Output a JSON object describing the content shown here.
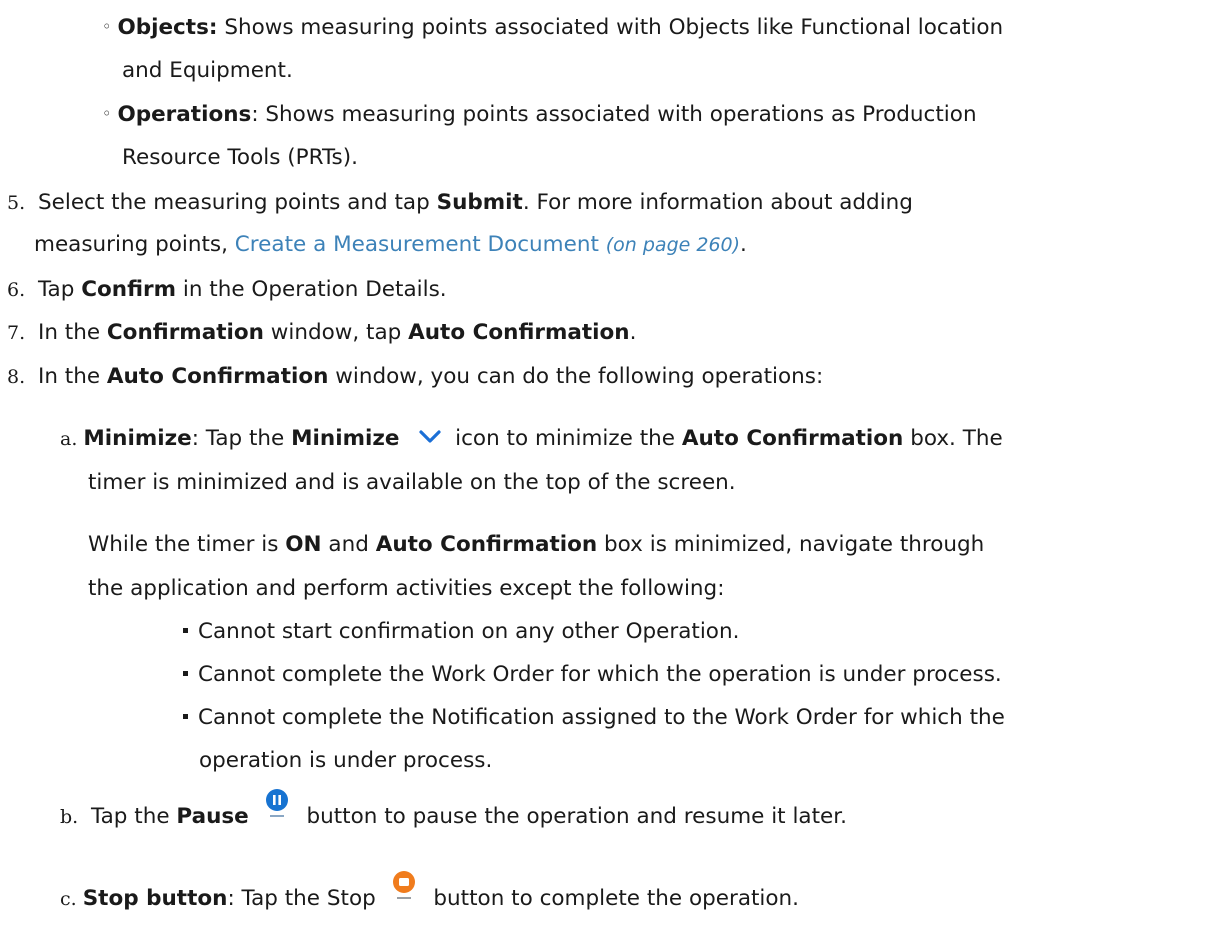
{
  "colors": {
    "text": "#1a1a1a",
    "link": "#3d82b8",
    "chevron": "#1b6fd6",
    "pause": "#1773d1",
    "stop": "#f07c1d"
  },
  "lines": {
    "objects_a": "Objects:",
    "objects_b": " Shows measuring points associated with Objects like Functional location",
    "objects_c": "and Equipment.",
    "ops_a": "Operations",
    "ops_b": ": Shows measuring points associated with operations as Production",
    "ops_c": "Resource Tools (PRTs).",
    "s5_num": "5.",
    "s5_a": " Select the measuring points and tap ",
    "s5_b": "Submit",
    "s5_c": ". For more information about adding",
    "s5_d": "measuring points, ",
    "s5_link": "Create a Measurement Document",
    "s5_link_page": "(on page 260)",
    "s5_e": ".",
    "s6_num": "6.",
    "s6_a": " Tap ",
    "s6_b": "Confirm",
    "s6_c": " in the Operation Details.",
    "s7_num": "7.",
    "s7_a": " In the ",
    "s7_b": "Confirmation",
    "s7_c": " window, tap ",
    "s7_d": "Auto Confirmation",
    "s7_e": ".",
    "s8_num": "8.",
    "s8_a": " In the ",
    "s8_b": "Auto Confirmation",
    "s8_c": " window, you can do the following operations:",
    "a_num": "a.",
    "a_b1": "Minimize",
    "a_t1": ": Tap the ",
    "a_b2": "Minimize",
    "a_t2": " icon to minimize the ",
    "a_b3": "Auto Confirmation",
    "a_t3": " box. The",
    "a_t4": "timer is minimized and is available on the top of the screen.",
    "p_t1": "While the timer is ",
    "p_b1": "ON",
    "p_t2": " and ",
    "p_b2": "Auto Confirmation",
    "p_t3": " box is minimized, navigate through",
    "p_t4": "the application and perform activities except the following:",
    "bul1": "Cannot start confirmation on any other Operation.",
    "bul2": "Cannot complete the Work Order for which the operation is under process.",
    "bul3a": "Cannot complete the Notification assigned to the Work Order for which the",
    "bul3b": "operation is under process.",
    "b_num": "b.",
    "b_t1": " Tap the ",
    "b_b1": "Pause",
    "b_t2": " button to pause the operation and resume it later.",
    "c_num": "c.",
    "c_b1": "Stop button",
    "c_t1": ": Tap the Stop ",
    "c_t2": " button to complete the operation."
  },
  "icons": {
    "chevron": "chevron-down-icon",
    "pause": "pause-icon",
    "stop": "stop-icon"
  }
}
